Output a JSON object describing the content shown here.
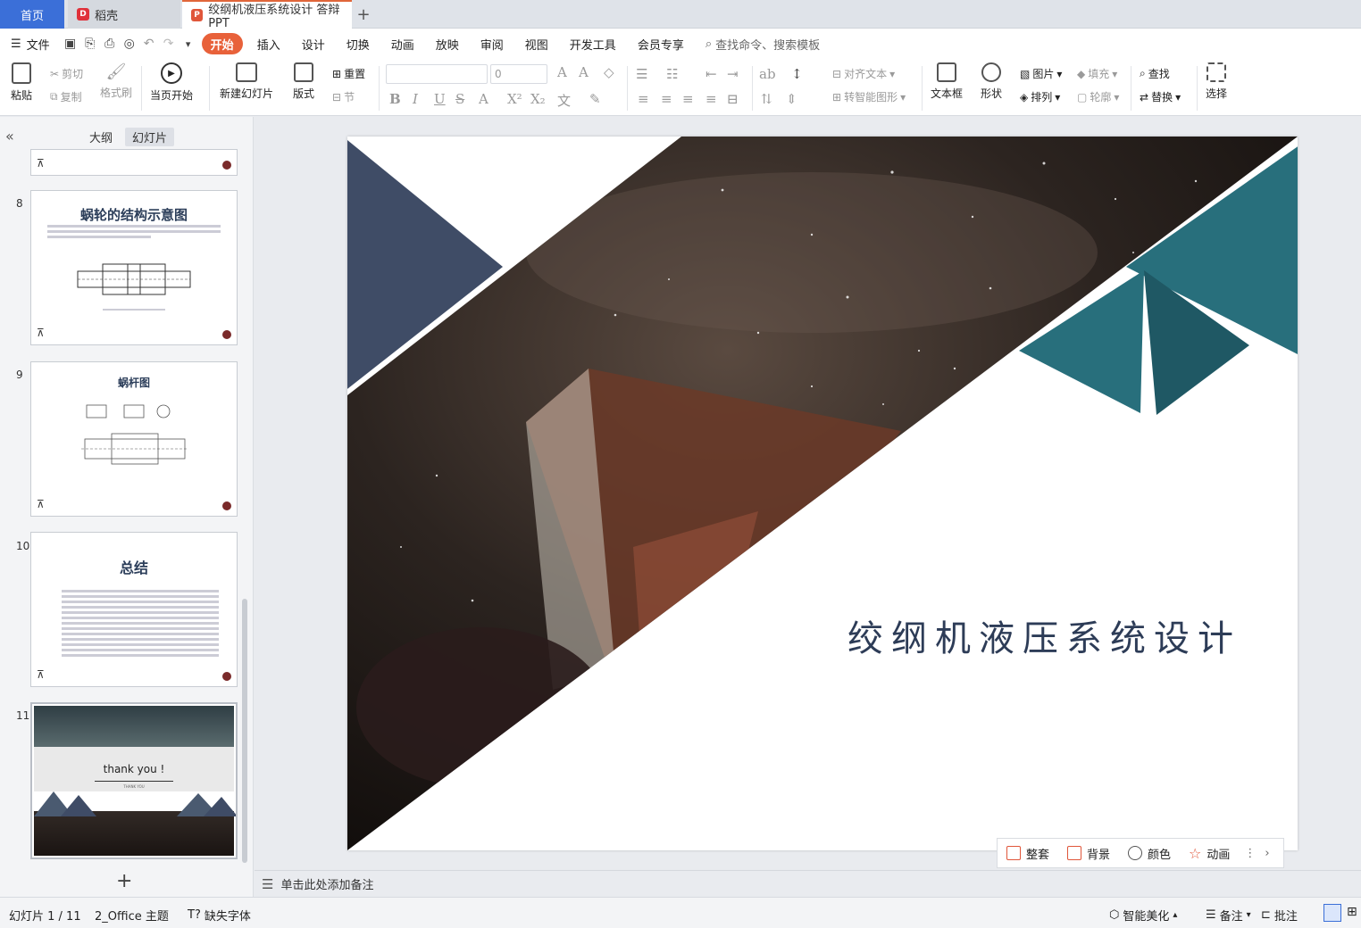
{
  "tabs": {
    "home": "首页",
    "wps": "稻壳",
    "doc": "绞纲机液压系统设计 答辩PPT",
    "add": "+"
  },
  "menu": {
    "file": "文件",
    "items": [
      "开始",
      "插入",
      "设计",
      "切换",
      "动画",
      "放映",
      "审阅",
      "视图",
      "开发工具",
      "会员专享"
    ],
    "search": "查找命令、搜索模板"
  },
  "ribbon": {
    "paste": "粘贴",
    "cut": "剪切",
    "copy": "复制",
    "format_painter": "格式刷",
    "from_current": "当页开始",
    "new_slide": "新建幻灯片",
    "layout": "版式",
    "reset": "重置",
    "section": "节",
    "font_size": "0",
    "align_text": "对齐文本",
    "smart_shape": "转智能图形",
    "textbox": "文本框",
    "shape": "形状",
    "picture": "图片",
    "arrange": "排列",
    "fill": "填充",
    "outline": "轮廓",
    "find": "查找",
    "replace": "替换",
    "select": "选择"
  },
  "left_panel": {
    "tab_outline": "大纲",
    "tab_slides": "幻灯片",
    "slides": [
      {
        "num": "8",
        "title": "蜗轮的结构示意图"
      },
      {
        "num": "9",
        "title": "蜗杆图"
      },
      {
        "num": "10",
        "title": "总结"
      },
      {
        "num": "11",
        "title": "thank you !",
        "subtitle": "THANK YOU"
      }
    ],
    "add": "+"
  },
  "slide": {
    "title": "绞纲机液压系统设计",
    "colors": {
      "navy": "#3f4c66",
      "teal": "#286f7c",
      "dark_teal": "#1f5864"
    }
  },
  "floatbar": {
    "items": [
      "整套",
      "背景",
      "颜色",
      "动画"
    ]
  },
  "notes": {
    "placeholder": "单击此处添加备注"
  },
  "status": {
    "slide_count": "幻灯片 1 / 11",
    "theme": "2_Office 主题",
    "missing_font": "缺失字体",
    "beautify": "智能美化",
    "notes": "备注",
    "comments": "批注"
  }
}
